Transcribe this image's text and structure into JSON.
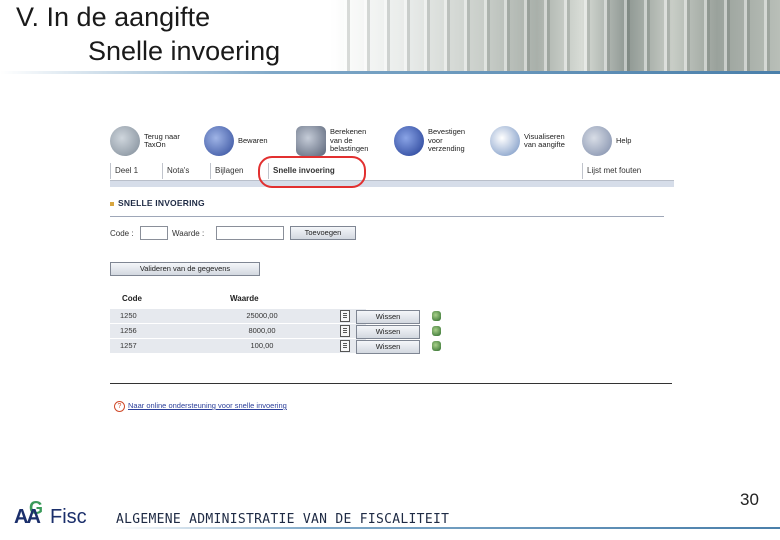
{
  "slide": {
    "title_line1": "V. In de aangifte",
    "title_line2": "Snelle invoering",
    "page_number": "30"
  },
  "toolbar": {
    "items": [
      {
        "label": "Terug naar\nTaxOn",
        "icon": "back-arrow-icon"
      },
      {
        "label": "Bewaren",
        "icon": "save-disk-icon"
      },
      {
        "label": "Berekenen\nvan de\nbelastingen",
        "icon": "calculator-icon"
      },
      {
        "label": "Bevestigen\nvoor\nverzending",
        "icon": "pen-sign-icon"
      },
      {
        "label": "Visualiseren\nvan aangifte",
        "icon": "eye-icon"
      },
      {
        "label": "Help",
        "icon": "question-mark-icon"
      }
    ]
  },
  "tabs": [
    {
      "label": "Deel 1"
    },
    {
      "label": "Nota's"
    },
    {
      "label": "Bijlagen"
    },
    {
      "label": "Snelle invoering",
      "active": true
    },
    {
      "label": "Lijst met fouten"
    }
  ],
  "form": {
    "section_title": "SNELLE INVOERING",
    "code_label": "Code :",
    "code_value": "",
    "waarde_label": "Waarde :",
    "waarde_value": "",
    "add_button": "Toevoegen",
    "validate_button": "Valideren van de gegevens"
  },
  "table": {
    "columns": [
      "Code",
      "Waarde"
    ],
    "rows": [
      {
        "code": "1250",
        "waarde": "25000,00",
        "action": "Wissen"
      },
      {
        "code": "1256",
        "waarde": "8000,00",
        "action": "Wissen"
      },
      {
        "code": "1257",
        "waarde": "100,00",
        "action": "Wissen"
      }
    ]
  },
  "help_link": "Naar online ondersteuning voor snelle invoering",
  "footer": {
    "logo_text": "AAFisc",
    "logo_letter": "G",
    "organization": "ALGEMENE ADMINISTRATIE VAN DE FISCALITEIT"
  },
  "colors": {
    "highlight": "#e23030",
    "tab_bar": "#d6dde9",
    "link": "#2b3f9a"
  }
}
